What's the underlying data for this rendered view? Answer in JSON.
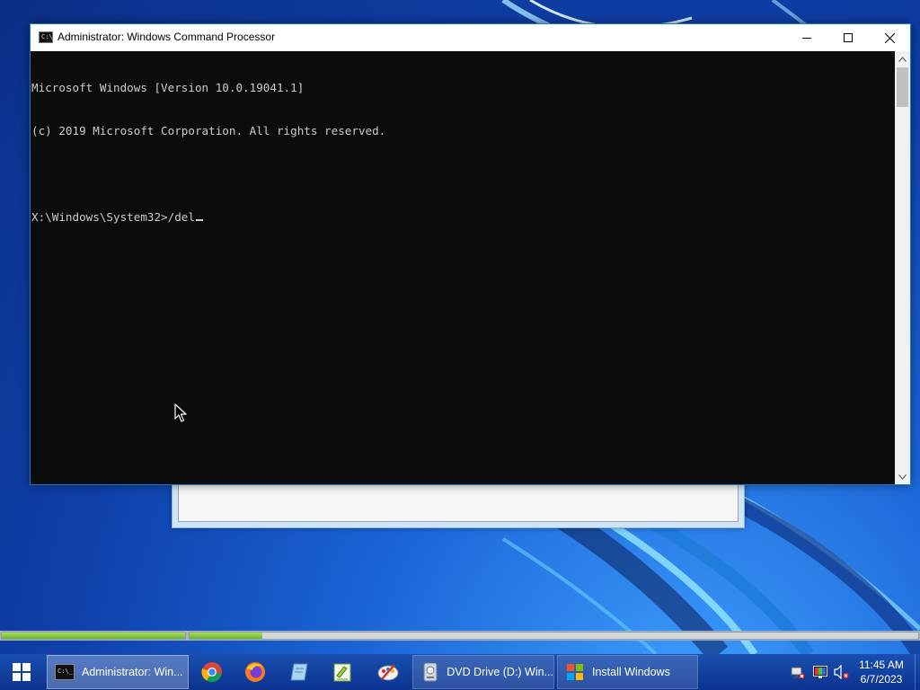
{
  "cmd_window": {
    "title": "Administrator: Windows Command Processor",
    "lines": [
      "Microsoft Windows [Version 10.0.19041.1]",
      "(c) 2019 Microsoft Corporation. All rights reserved.",
      "",
      "X:\\Windows\\System32>/del"
    ],
    "caption_buttons": {
      "minimize": "minimize-icon",
      "maximize": "maximize-icon",
      "close": "close-icon"
    }
  },
  "progress": {
    "collecting_information": 1.0,
    "installing_windows": 0.1
  },
  "taskbar": {
    "tasks": [
      {
        "label": "Administrator: Win...",
        "icon": "cmd-icon"
      },
      {
        "label": "DVD Drive (D:) Win...",
        "icon": "dvd-drive-icon"
      },
      {
        "label": "Install Windows",
        "icon": "windows-setup-icon"
      }
    ],
    "pinned": [
      "chrome-icon",
      "firefox-icon",
      "notepad-icon",
      "notepadpp-icon",
      "paint-icon"
    ],
    "tray": [
      "network-disconnected-icon",
      "display-color-icon",
      "volume-muted-icon"
    ],
    "clock": {
      "time": "11:45 AM",
      "date": "6/7/2023"
    }
  },
  "colors": {
    "console_bg": "#0c0c0c",
    "console_fg": "#cccccc",
    "progress_fill": "#7ec23a",
    "taskbar": "#0e3b9a"
  }
}
